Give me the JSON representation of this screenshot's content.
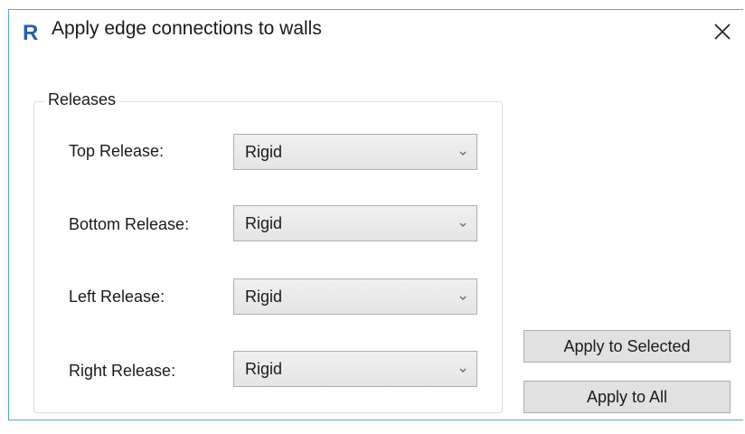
{
  "window": {
    "title": "Apply edge connections to walls",
    "app_icon_letter": "R",
    "app_icon_color": "#2a5fa8"
  },
  "releases": {
    "group_label": "Releases",
    "rows": [
      {
        "label": "Top Release:",
        "value": "Rigid"
      },
      {
        "label": "Bottom Release:",
        "value": "Rigid"
      },
      {
        "label": "Left Release:",
        "value": "Rigid"
      },
      {
        "label": "Right Release:",
        "value": "Rigid"
      }
    ]
  },
  "actions": {
    "apply_selected_label": "Apply to Selected",
    "apply_all_label": "Apply to All"
  }
}
